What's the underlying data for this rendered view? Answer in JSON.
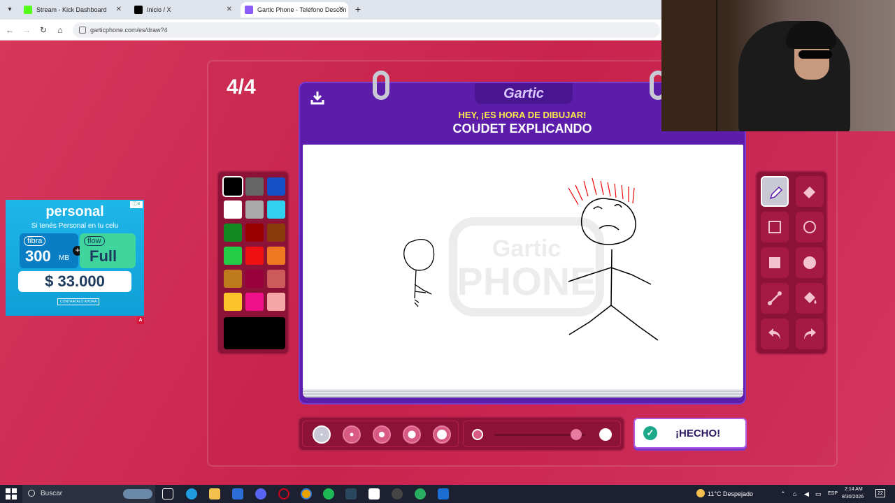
{
  "browser": {
    "tabs": [
      {
        "title": "Stream - Kick Dashboard",
        "favicon_color": "#53fc18",
        "active": false
      },
      {
        "title": "Inicio / X",
        "favicon_color": "#000000",
        "active": false
      },
      {
        "title": "Gartic Phone - Teléfono Descon",
        "favicon_color": "#8b5cf6",
        "active": true
      }
    ],
    "url": "garticphone.com/es/draw?4"
  },
  "game": {
    "round": "4/4",
    "logo": "Gartic",
    "hint": "HEY, ¡ES HORA DE DIBUJAR!",
    "prompt": "COUDET EXPLICANDO",
    "watermark_top": "Gartic",
    "watermark_bottom": "PHONE",
    "done_label": "¡HECHO!",
    "colors": [
      "#000000",
      "#666666",
      "#1450c8",
      "#ffffff",
      "#aaaaaa",
      "#2fd0f0",
      "#118822",
      "#990000",
      "#8c3c0a",
      "#22cc44",
      "#ee1111",
      "#ee7722",
      "#c07a1e",
      "#99003c",
      "#cc5a5a",
      "#fcc22a",
      "#f0108a",
      "#f4a6a6"
    ],
    "selected_color": "#000000",
    "tools": [
      "pencil-icon",
      "eraser-icon",
      "rectangle-outline-icon",
      "circle-outline-icon",
      "rectangle-fill-icon",
      "circle-fill-icon",
      "line-icon",
      "bucket-icon",
      "undo-icon",
      "redo-icon"
    ],
    "brush_sizes": [
      1,
      2,
      3,
      4,
      5
    ],
    "selected_size": 1,
    "opacity": 0.9
  },
  "ad": {
    "brand": "personal",
    "tagline": "Si tenés Personal en tu celu",
    "offer1_label": "fibra",
    "offer1_value": "300",
    "offer1_unit": "MB",
    "offer2_label": "flow",
    "offer2_value": "Full",
    "price": "$ 33.000",
    "cta": "CONTRATALO AHORA",
    "corner": "A"
  },
  "taskbar": {
    "search_placeholder": "Buscar",
    "weather": "11°C  Despejado",
    "language": "ESP",
    "time": "2:14 AM",
    "date": "8/30/2026",
    "notification_count": "22"
  }
}
